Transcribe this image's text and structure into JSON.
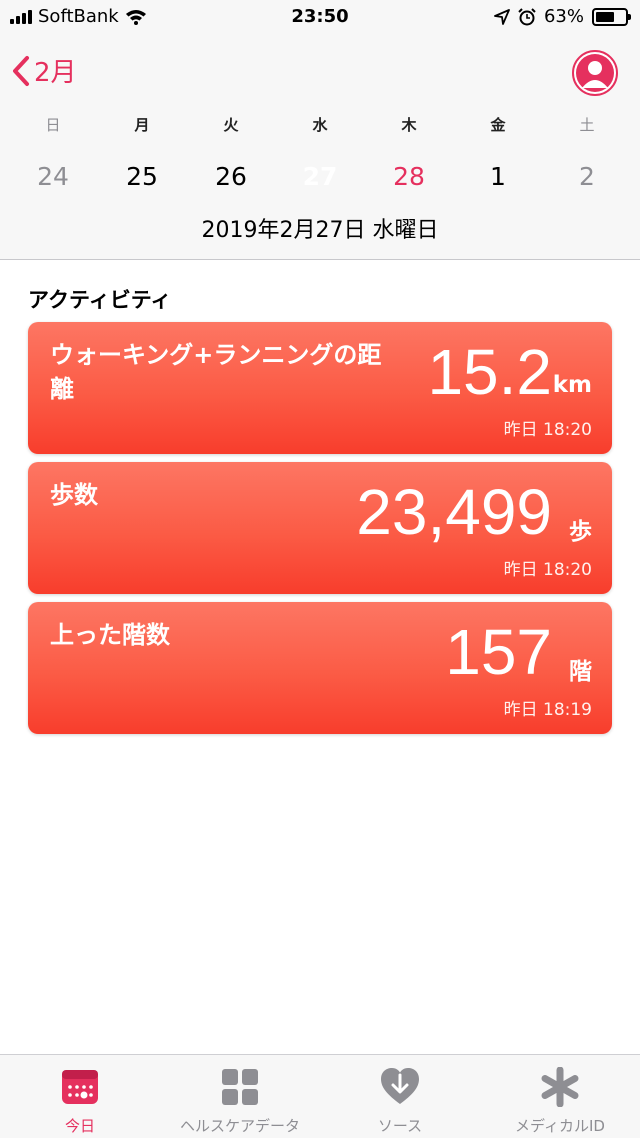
{
  "status_bar": {
    "carrier": "SoftBank",
    "time": "23:50",
    "battery": "63%",
    "battery_level": 0.63
  },
  "nav": {
    "back_label": "2月"
  },
  "calendar": {
    "weekdays": [
      "日",
      "月",
      "火",
      "水",
      "木",
      "金",
      "土"
    ],
    "days": [
      "24",
      "25",
      "26",
      "27",
      "28",
      "1",
      "2"
    ],
    "selected_index": 3,
    "date_title": "2019年2月27日 水曜日"
  },
  "activity": {
    "section_title": "アクティビティ",
    "cards": [
      {
        "label": "ウォーキング+ランニングの距離",
        "value": "15.2",
        "unit": "km",
        "time": "昨日 18:20"
      },
      {
        "label": "歩数",
        "value": "23,499",
        "unit": "歩",
        "time": "昨日 18:20"
      },
      {
        "label": "上った階数",
        "value": "157",
        "unit": "階",
        "time": "昨日 18:19"
      }
    ]
  },
  "tabbar": {
    "tabs": [
      {
        "label": "今日",
        "icon": "today-icon"
      },
      {
        "label": "ヘルスケアデータ",
        "icon": "grid-icon"
      },
      {
        "label": "ソース",
        "icon": "sources-heart-icon"
      },
      {
        "label": "メディカルID",
        "icon": "medical-asterisk-icon"
      }
    ],
    "active_index": 0
  },
  "colors": {
    "accent": "#e5305e",
    "card": "#fb5b45"
  }
}
